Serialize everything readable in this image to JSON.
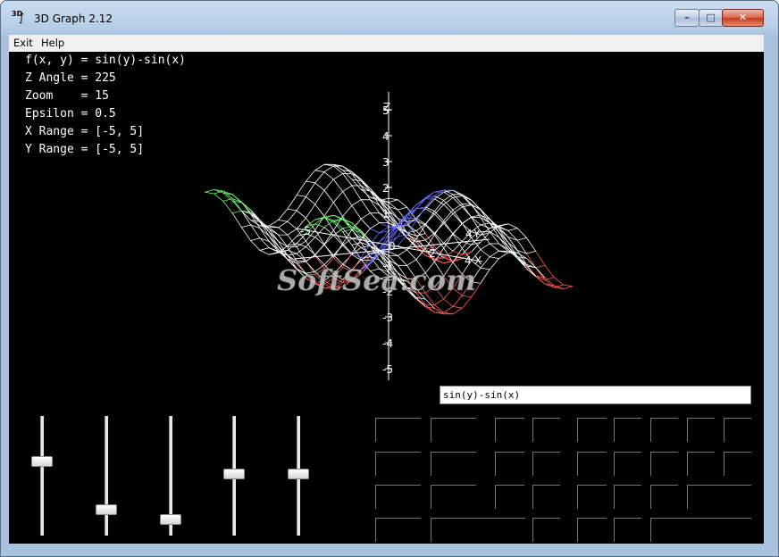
{
  "window": {
    "title": "3D Graph 2.12",
    "icon_label": "3D",
    "controls": {
      "minimize": "–",
      "maximize": "□",
      "close": "✕"
    }
  },
  "menu": {
    "items": [
      "Exit",
      "Help"
    ]
  },
  "info": {
    "function": "f(x, y) = sin(y)-sin(x)",
    "z_angle": "Z Angle = 225",
    "zoom": "Zoom    = 15",
    "epsilon": "Epsilon = 0.5",
    "x_range": "X Range = [-5, 5]",
    "y_range": "Y Range = [-5, 5]"
  },
  "graph": {
    "z_axis_label": "Z",
    "x_axis_label": "X",
    "y_axis_label": "Y",
    "z_ticks": [
      "5",
      "4",
      "3",
      "2",
      "1",
      "-1",
      "-2",
      "-3",
      "-4",
      "-5"
    ],
    "x_ticks": [
      "2",
      "4"
    ],
    "y_ticks": [
      "4",
      "-5"
    ],
    "origin_label": "0",
    "watermark": "SoftSea.com",
    "surface_color": "#ffffff"
  },
  "function_input": {
    "value": "sin(y)-sin(x)"
  },
  "sliders": [
    {
      "name": "z-angle-slider",
      "level": 0.37
    },
    {
      "name": "zoom-slider",
      "level": 0.81
    },
    {
      "name": "epsilon-slider",
      "level": 0.9
    },
    {
      "name": "x-range-slider",
      "level": 0.48
    },
    {
      "name": "y-range-slider",
      "level": 0.48
    }
  ]
}
